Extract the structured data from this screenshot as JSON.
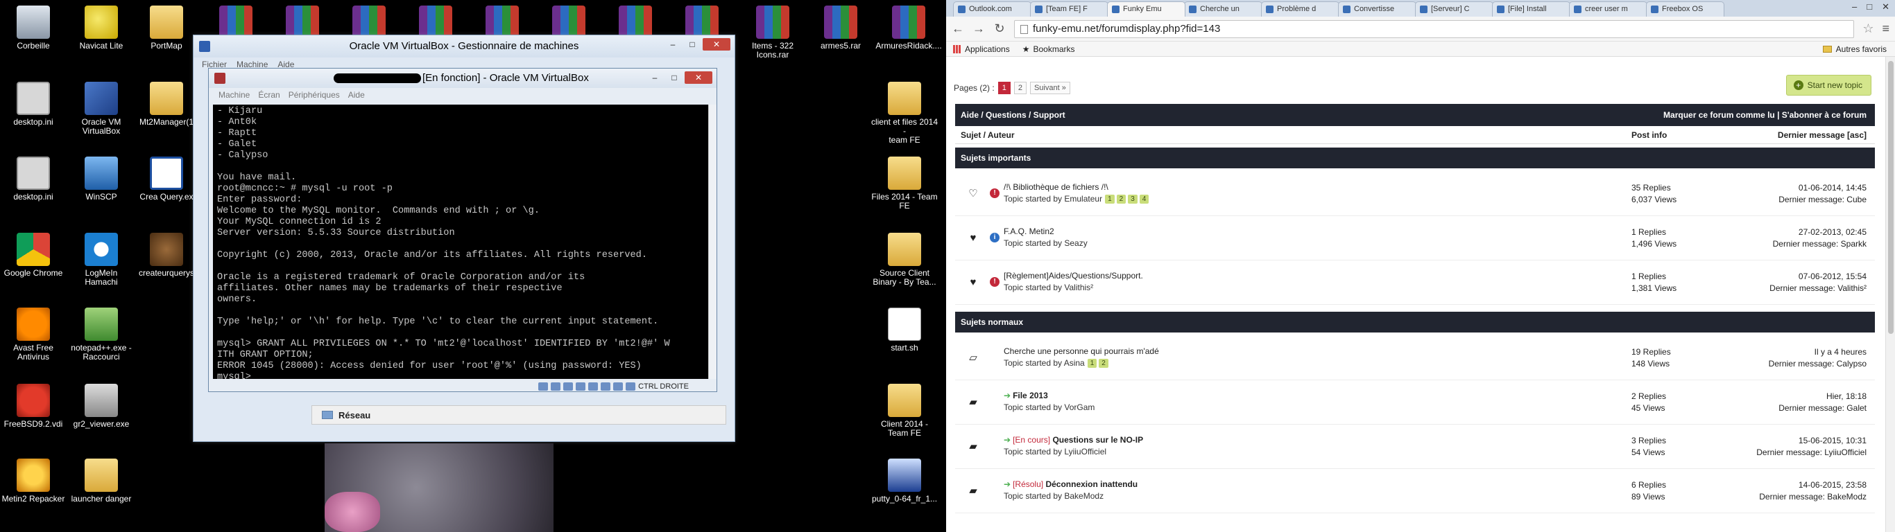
{
  "desktop": {
    "icons": [
      {
        "label": "Corbeille",
        "kind": "bin"
      },
      {
        "label": "Navicat Lite",
        "kind": "navicat"
      },
      {
        "label": "PortMap",
        "kind": "folder"
      },
      {
        "label": "desktop.ini",
        "kind": "file"
      },
      {
        "label": "Oracle VM\nVirtualBox",
        "kind": "vbox"
      },
      {
        "label": "Mt2Manager(1",
        "kind": "folder"
      },
      {
        "label": "desktop.ini",
        "kind": "file"
      },
      {
        "label": "WinSCP",
        "kind": "winscp"
      },
      {
        "label": "Crea Query.ex",
        "kind": "crea"
      },
      {
        "label": "Google Chrome",
        "kind": "chrome"
      },
      {
        "label": "LogMeIn\nHamachi",
        "kind": "hamachi"
      },
      {
        "label": "createurquerys",
        "kind": "bag"
      },
      {
        "label": "Avast Free\nAntivirus",
        "kind": "avast"
      },
      {
        "label": "notepad++.exe -\nRaccourci",
        "kind": "notepad"
      },
      {
        "label": "FreeBSD9.2.vdi",
        "kind": "freebsd"
      },
      {
        "label": "gr2_viewer.exe",
        "kind": "gr2"
      },
      {
        "label": "Metin2 Repacker",
        "kind": "metin"
      },
      {
        "label": "launcher danger",
        "kind": "folder"
      },
      {
        "label": "Items - 322\nIcons.rar",
        "kind": "rar"
      },
      {
        "label": "armes5.rar",
        "kind": "rar"
      },
      {
        "label": "ArmuresRidack....",
        "kind": "rar"
      },
      {
        "label": "client et files 2014 -\nteam FE",
        "kind": "folder"
      },
      {
        "label": "Files 2014 - Team\nFE",
        "kind": "folder"
      },
      {
        "label": "Source Client\nBinary - By Tea...",
        "kind": "folder"
      },
      {
        "label": "start.sh",
        "kind": "sh"
      },
      {
        "label": "Client 2014 -\nTeam FE",
        "kind": "folder"
      },
      {
        "label": "putty_0-64_fr_1...",
        "kind": "putty"
      },
      {
        "label": "",
        "kind": "rar"
      },
      {
        "label": "",
        "kind": "rar"
      },
      {
        "label": "",
        "kind": "rar"
      },
      {
        "label": "",
        "kind": "rar"
      },
      {
        "label": "",
        "kind": "rar"
      },
      {
        "label": "",
        "kind": "rar"
      },
      {
        "label": "",
        "kind": "rar"
      },
      {
        "label": "",
        "kind": "rar"
      }
    ]
  },
  "vbox_manager": {
    "title": "Oracle VM VirtualBox - Gestionnaire de machines",
    "menu": [
      "Fichier",
      "Machine",
      "Aide"
    ],
    "network_panel": "Réseau"
  },
  "vm_window": {
    "title_suffix": "[En fonction] - Oracle VM VirtualBox",
    "menu": [
      "Machine",
      "Écran",
      "Périphériques",
      "Aide"
    ],
    "terminal": "- Kijaru\n- Ant0k\n- Raptt\n- Galet\n- Calypso\n\nYou have mail.\nroot@mcncc:~ # mysql -u root -p\nEnter password:\nWelcome to the MySQL monitor.  Commands end with ; or \\g.\nYour MySQL connection id is 2\nServer version: 5.5.33 Source distribution\n\nCopyright (c) 2000, 2013, Oracle and/or its affiliates. All rights reserved.\n\nOracle is a registered trademark of Oracle Corporation and/or its\naffiliates. Other names may be trademarks of their respective\nowners.\n\nType 'help;' or '\\h' for help. Type '\\c' to clear the current input statement.\n\nmysql> GRANT ALL PRIVILEGES ON *.* TO 'mt2'@'localhost' IDENTIFIED BY 'mt2!@#' W\nITH GRANT OPTION;\nERROR 1045 (28000): Access denied for user 'root'@'%' (using password: YES)\nmysql> _",
    "host_key": "CTRL DROITE"
  },
  "browser": {
    "tabs": [
      {
        "label": "Outlook.com",
        "active": false
      },
      {
        "label": "[Team FE] F",
        "active": false
      },
      {
        "label": "Funky Emu",
        "active": true
      },
      {
        "label": "Cherche un",
        "active": false
      },
      {
        "label": "Problème d",
        "active": false
      },
      {
        "label": "Convertisse",
        "active": false
      },
      {
        "label": "[Serveur] C",
        "active": false
      },
      {
        "label": "[File] Install",
        "active": false
      },
      {
        "label": "creer user m",
        "active": false
      },
      {
        "label": "Freebox OS",
        "active": false
      }
    ],
    "url": "funky-emu.net/forumdisplay.php?fid=143",
    "bookmarks": [
      "Applications",
      "Bookmarks"
    ],
    "other_bookmarks": "Autres favoris"
  },
  "forum": {
    "pages_label": "Pages (2) :",
    "pages": [
      "1",
      "2"
    ],
    "next_label": "Suivant »",
    "new_topic": "Start new topic",
    "forum_title": "Aide / Questions / Support",
    "forum_actions": "Marquer ce forum comme lu | S'abonner à ce forum",
    "col_subject": "Sujet / Auteur",
    "col_info": "Post info",
    "col_last": "Dernier message [asc]",
    "sticky_header": "Sujets importants",
    "normal_header": "Sujets normaux",
    "sticky": [
      {
        "prefix": "",
        "title": "/!\\ Bibliothèque de fichiers /!\\",
        "by": "Topic started by Emulateur",
        "pages": [
          "1",
          "2",
          "3",
          "4"
        ],
        "replies": "35 Replies",
        "views": "6,037 Views",
        "last_date": "01-06-2014, 14:45",
        "last_by": "Dernier message: Cube",
        "ico1": "heart-outline",
        "ico2": "!",
        "ico2_color": "#c3283a"
      },
      {
        "prefix": "",
        "title": "F.A.Q. Metin2",
        "by": "Topic started by Seazy",
        "pages": [],
        "replies": "1 Replies",
        "views": "1,496 Views",
        "last_date": "27-02-2013, 02:45",
        "last_by": "Dernier message: Sparkk",
        "ico1": "heart-filled",
        "ico2": "i",
        "ico2_color": "#2d6fc4"
      },
      {
        "prefix": "",
        "title": "[Règlement]Aides/Questions/Support.",
        "by": "Topic started by Valithis²",
        "pages": [],
        "replies": "1 Replies",
        "views": "1,381 Views",
        "last_date": "07-06-2012, 15:54",
        "last_by": "Dernier message: Valithis²",
        "ico1": "heart-filled",
        "ico2": "!",
        "ico2_color": "#c3283a"
      }
    ],
    "normal": [
      {
        "prefix": "",
        "arrow": false,
        "title": "Cherche une personne qui pourrais m'adé",
        "by": "Topic started by Asina",
        "pages": [
          "1",
          "2"
        ],
        "replies": "19 Replies",
        "views": "148 Views",
        "last_date": "Il y a 4 heures",
        "last_by": "Dernier message: Calypso",
        "ico1": "folder-outline"
      },
      {
        "prefix": "",
        "arrow": true,
        "title": "File 2013",
        "by": "Topic started by VorGam",
        "pages": [],
        "replies": "2 Replies",
        "views": "45 Views",
        "last_date": "Hier, 18:18",
        "last_by": "Dernier message: Galet",
        "ico1": "folder-filled"
      },
      {
        "prefix": "[En cours]",
        "arrow": true,
        "title": "Questions sur le NO-IP",
        "by": "Topic started by LyiiuOfficiel",
        "pages": [],
        "replies": "3 Replies",
        "views": "54 Views",
        "last_date": "15-06-2015, 10:31",
        "last_by": "Dernier message: LyiiuOfficiel",
        "ico1": "folder-filled"
      },
      {
        "prefix": "[Résolu]",
        "arrow": true,
        "title": "Déconnexion inattendu",
        "by": "Topic started by BakeModz",
        "pages": [],
        "replies": "6 Replies",
        "views": "89 Views",
        "last_date": "14-06-2015, 23:58",
        "last_by": "Dernier message: BakeModz",
        "ico1": "folder-filled"
      }
    ]
  }
}
